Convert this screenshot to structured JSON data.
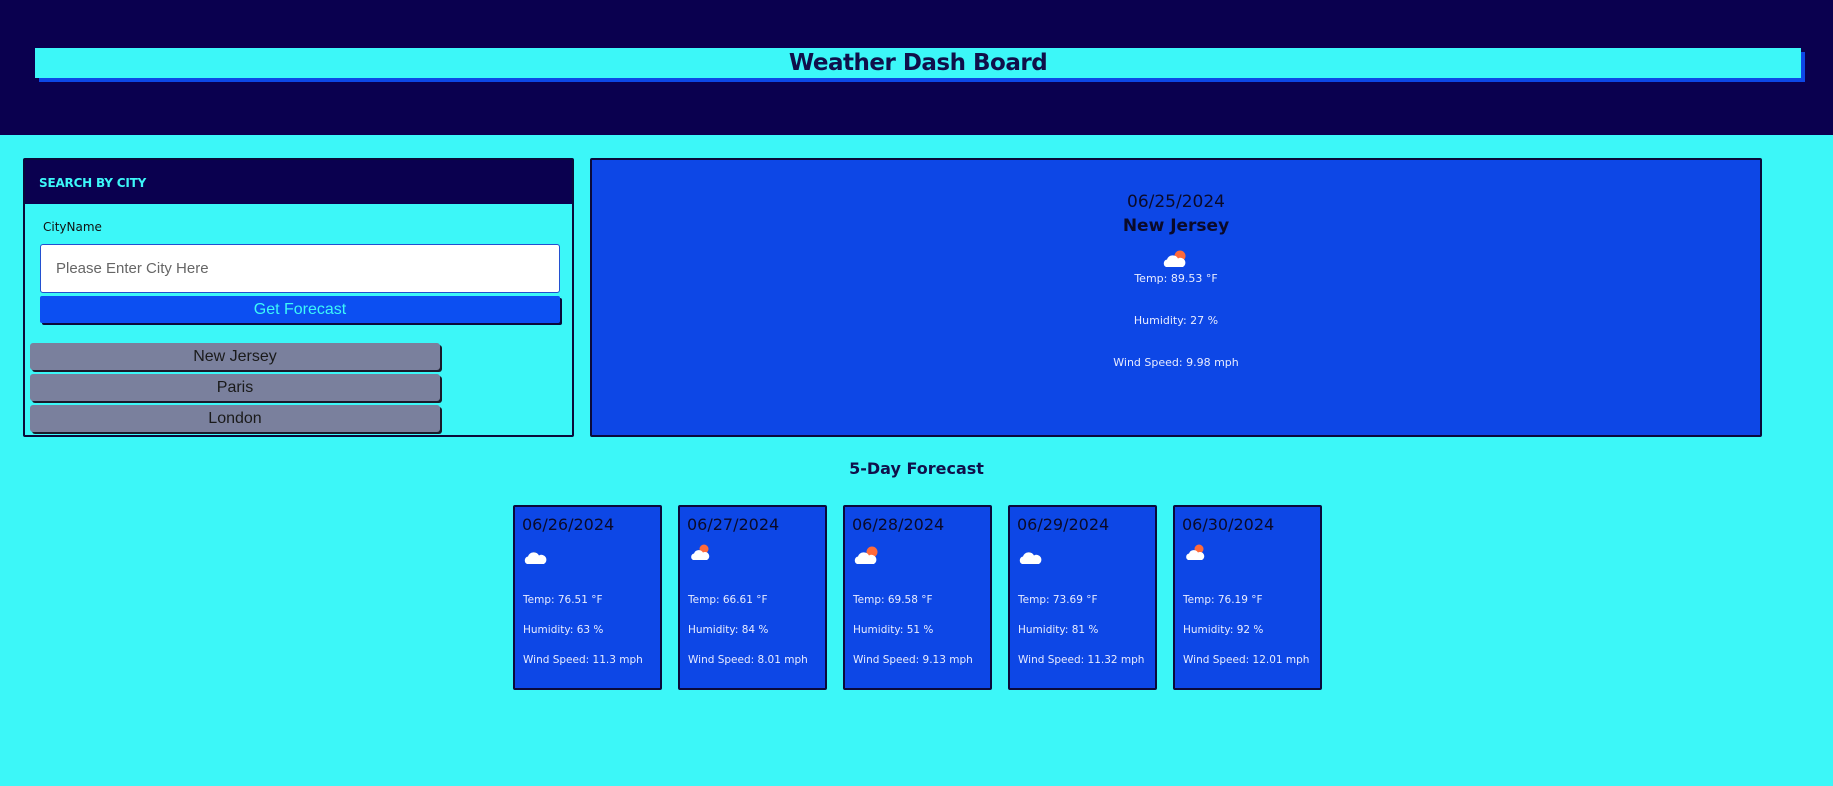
{
  "header": {
    "title": "Weather Dash Board"
  },
  "search": {
    "heading": "SEARCH BY CITY",
    "label": "CityName",
    "placeholder": "Please Enter City Here",
    "value": "",
    "button_label": "Get Forecast",
    "history": [
      "New Jersey",
      "Paris",
      "London"
    ]
  },
  "current": {
    "date": "06/25/2024",
    "city": "New Jersey",
    "icon": "sun-behind-cloud-icon",
    "temp": "Temp: 89.53 °F",
    "humidity": "Humidity: 27 %",
    "wind": "Wind Speed: 9.98 mph"
  },
  "forecast": {
    "title": "5-Day Forecast",
    "days": [
      {
        "date": "06/26/2024",
        "icon": "cloud-moon-icon",
        "temp": "Temp: 76.51 °F",
        "humidity": "Humidity: 63 %",
        "wind": "Wind Speed: 11.3 mph"
      },
      {
        "date": "06/27/2024",
        "icon": "sun-behind-cloud-icon",
        "temp": "Temp: 66.61 °F",
        "humidity": "Humidity: 84 %",
        "wind": "Wind Speed: 8.01 mph"
      },
      {
        "date": "06/28/2024",
        "icon": "sun-behind-cloud-icon",
        "temp": "Temp: 69.58 °F",
        "humidity": "Humidity: 51 %",
        "wind": "Wind Speed: 9.13 mph"
      },
      {
        "date": "06/29/2024",
        "icon": "cloud-moon-icon",
        "temp": "Temp: 73.69 °F",
        "humidity": "Humidity: 81 %",
        "wind": "Wind Speed: 11.32 mph"
      },
      {
        "date": "06/30/2024",
        "icon": "sun-behind-cloud-icon",
        "temp": "Temp: 76.19 °F",
        "humidity": "Humidity: 92 %",
        "wind": "Wind Speed: 12.01 mph"
      }
    ]
  },
  "colors": {
    "page_bg": "#3cf7f8",
    "header_bg": "#0a004f",
    "card_bg": "#0d47e6",
    "history_btn": "#7a809d"
  }
}
